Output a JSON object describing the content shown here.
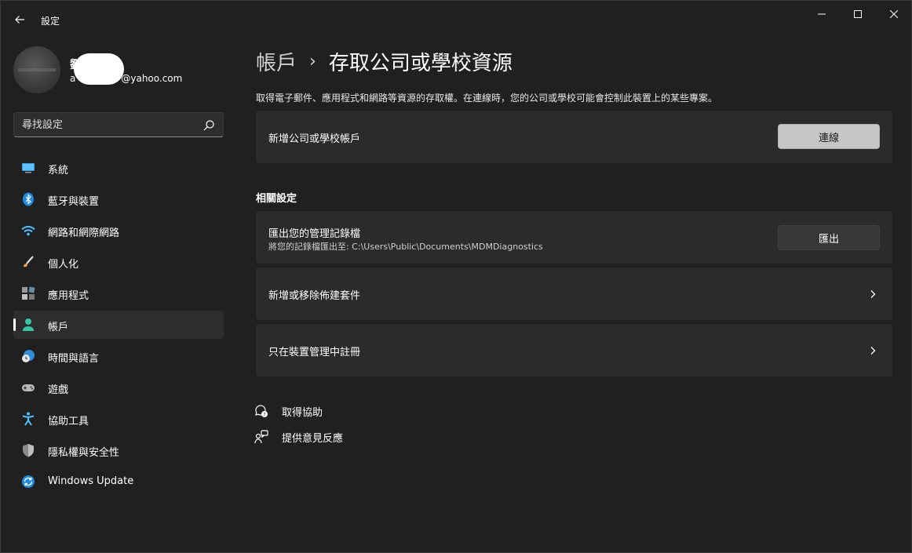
{
  "app": {
    "title": "設定"
  },
  "profile": {
    "name": "劉",
    "email": "a@yahoo.com",
    "email_visible": "a",
    "email_domain": "@yahoo.com"
  },
  "search": {
    "placeholder": "尋找設定"
  },
  "nav": {
    "items": [
      {
        "label": "系統",
        "icon": "monitor-icon"
      },
      {
        "label": "藍牙與裝置",
        "icon": "bluetooth-icon"
      },
      {
        "label": "網路和網際網路",
        "icon": "wifi-icon"
      },
      {
        "label": "個人化",
        "icon": "paintbrush-icon"
      },
      {
        "label": "應用程式",
        "icon": "apps-icon"
      },
      {
        "label": "帳戶",
        "icon": "person-icon",
        "active": true
      },
      {
        "label": "時間與語言",
        "icon": "globe-clock-icon"
      },
      {
        "label": "遊戲",
        "icon": "gamepad-icon"
      },
      {
        "label": "協助工具",
        "icon": "accessibility-icon"
      },
      {
        "label": "隱私權與安全性",
        "icon": "shield-icon"
      },
      {
        "label": "Windows Update",
        "icon": "windows-update-icon"
      }
    ]
  },
  "main": {
    "breadcrumb_parent": "帳戶",
    "breadcrumb_separator": "›",
    "page_title": "存取公司或學校資源",
    "description": "取得電子郵件、應用程式和網路等資源的存取權。在連線時，您的公司或學校可能會控制此裝置上的某些專案。",
    "add_account": {
      "label": "新增公司或學校帳戶",
      "button": "連線"
    },
    "related_heading": "相關設定",
    "export_logs": {
      "label": "匯出您的管理記錄檔",
      "sub": "將您的記錄檔匯出至: C:\\Users\\Public\\Documents\\MDMDiagnostics",
      "button": "匯出"
    },
    "provisioning": {
      "label": "新增或移除佈建套件"
    },
    "enroll_only": {
      "label": "只在裝置管理中註冊"
    },
    "links": {
      "get_help": "取得協助",
      "feedback": "提供意見反應"
    }
  },
  "colors": {
    "background": "#202020",
    "card": "#2b2b2b",
    "accent": "#4cc2ff"
  }
}
